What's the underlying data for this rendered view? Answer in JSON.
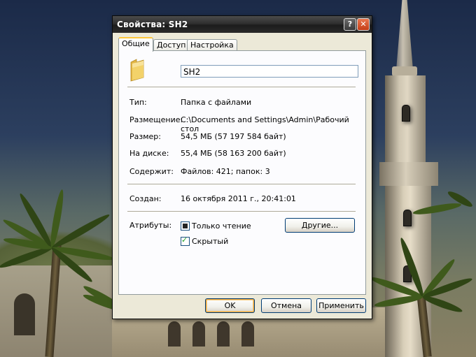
{
  "window": {
    "title": "Свойства: SH2",
    "help_symbol": "?",
    "close_symbol": "✕"
  },
  "tabs": [
    {
      "label": "Общие",
      "active": true
    },
    {
      "label": "Доступ",
      "active": false
    },
    {
      "label": "Настройка",
      "active": false
    }
  ],
  "general": {
    "folder_icon": "folder-icon",
    "name_value": "SH2",
    "type": {
      "label": "Тип:",
      "value": "Папка с файлами"
    },
    "location": {
      "label": "Размещение:",
      "value": "C:\\Documents and Settings\\Admin\\Рабочий стол"
    },
    "size": {
      "label": "Размер:",
      "value": "54,5 МБ (57 197 584 байт)"
    },
    "size_on_disk": {
      "label": "На диске:",
      "value": "55,4 МБ (58 163 200 байт)"
    },
    "contains": {
      "label": "Содержит:",
      "value": "Файлов: 421; папок: 3"
    },
    "created": {
      "label": "Создан:",
      "value": "16 октября 2011 г., 20:41:01"
    },
    "attributes": {
      "label": "Атрибуты:",
      "read_only": {
        "label": "Только чтение",
        "state": "indeterminate"
      },
      "hidden": {
        "label": "Скрытый",
        "state": "checked"
      },
      "advanced_button": "Другие..."
    }
  },
  "buttons": {
    "ok": "OK",
    "cancel": "Отмена",
    "apply": "Применить"
  },
  "colors": {
    "dialog_bg": "#ece9d8",
    "titlebar": "#2f2f2f",
    "active_tab_accent": "#ffc83c",
    "close_button": "#c43d16",
    "folder_yellow": "#f3d26a"
  }
}
